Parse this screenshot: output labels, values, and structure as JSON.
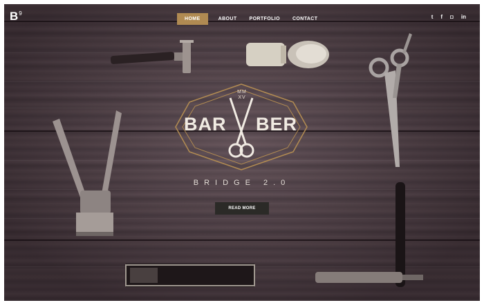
{
  "logo": {
    "letter": "B",
    "superscript": "9"
  },
  "nav": {
    "items": [
      {
        "label": "HOME",
        "active": true
      },
      {
        "label": "ABOUT",
        "active": false
      },
      {
        "label": "PORTFOLIO",
        "active": false
      },
      {
        "label": "CONTACT",
        "active": false
      }
    ]
  },
  "social": {
    "twitter": "t",
    "facebook": "f",
    "instagram": "◘",
    "linkedin": "in"
  },
  "hero": {
    "brand_left": "BAR",
    "brand_right": "BER",
    "roman_top": "MM",
    "roman_bottom": "XV",
    "subtitle": "BRIDGE 2.0",
    "button_label": "READ MORE"
  },
  "colors": {
    "accent": "#b08a52",
    "button_bg": "#2b2a27",
    "emblem_line": "#b08a52"
  },
  "icons": [
    "twitter-icon",
    "facebook-icon",
    "instagram-icon",
    "linkedin-icon",
    "scissors-icon"
  ]
}
